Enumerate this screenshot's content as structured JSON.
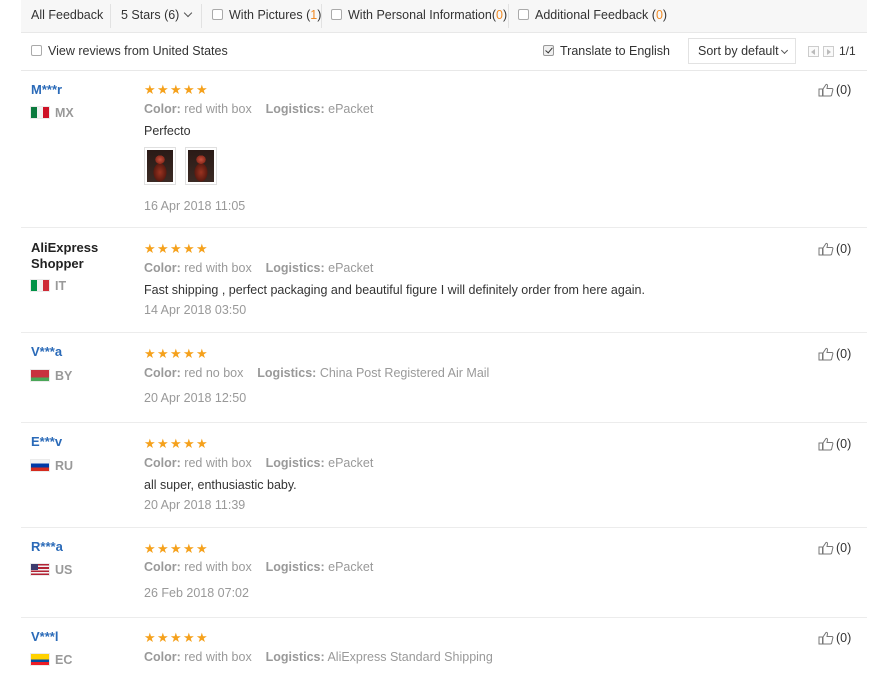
{
  "filters": {
    "all_feedback": "All Feedback",
    "stars": "5 Stars (6)",
    "with_pictures": {
      "label": "With Pictures",
      "open": "(",
      "count": "1",
      "close": ")"
    },
    "with_personal": {
      "label": "With Personal Information",
      "open": "(",
      "count": "0",
      "close": ")"
    },
    "additional": {
      "label": "Additional Feedback",
      "open": "(",
      "count": "0",
      "close": ")"
    }
  },
  "toolbar": {
    "view_us": "View reviews from United States",
    "translate": "Translate to English",
    "sort": "Sort by default",
    "pages": "1/1"
  },
  "labels": {
    "color": "Color:",
    "logistics": "Logistics:"
  },
  "reviews": [
    {
      "user": "M***r",
      "country": "MX",
      "flag": "mx",
      "color": "red with box",
      "logistics": "ePacket",
      "text": "Perfecto",
      "date": "16 Apr 2018 11:05",
      "likes": "(0)",
      "has_pictures": true
    },
    {
      "user": "AliExpress Shopper",
      "user_line1": "AliExpress",
      "user_line2": "Shopper",
      "country": "IT",
      "flag": "it",
      "color": "red with box",
      "logistics": "ePacket",
      "text": "Fast shipping , perfect packaging and beautiful figure I will definitely order from here again.",
      "date": "14 Apr 2018 03:50",
      "likes": "(0)"
    },
    {
      "user": "V***a",
      "country": "BY",
      "flag": "by",
      "color": "red no box",
      "logistics": "China Post Registered Air Mail",
      "text": "",
      "date": "20 Apr 2018 12:50",
      "likes": "(0)"
    },
    {
      "user": "E***v",
      "country": "RU",
      "flag": "ru",
      "color": "red with box",
      "logistics": "ePacket",
      "text": "all super, enthusiastic baby.",
      "date": "20 Apr 2018 11:39",
      "likes": "(0)"
    },
    {
      "user": "R***a",
      "country": "US",
      "flag": "us",
      "color": "red with box",
      "logistics": "ePacket",
      "text": "",
      "date": "26 Feb 2018 07:02",
      "likes": "(0)"
    },
    {
      "user": "V***l",
      "country": "EC",
      "flag": "ec",
      "color": "red with box",
      "logistics": "AliExpress Standard Shipping",
      "text": "",
      "date": "",
      "likes": "(0)"
    }
  ],
  "rating": {
    "stars": 5,
    "max": 5
  },
  "colors": {
    "star": "#f5a11c",
    "link": "#2a6ab8",
    "count": "#f08a24",
    "muted": "#999999"
  }
}
